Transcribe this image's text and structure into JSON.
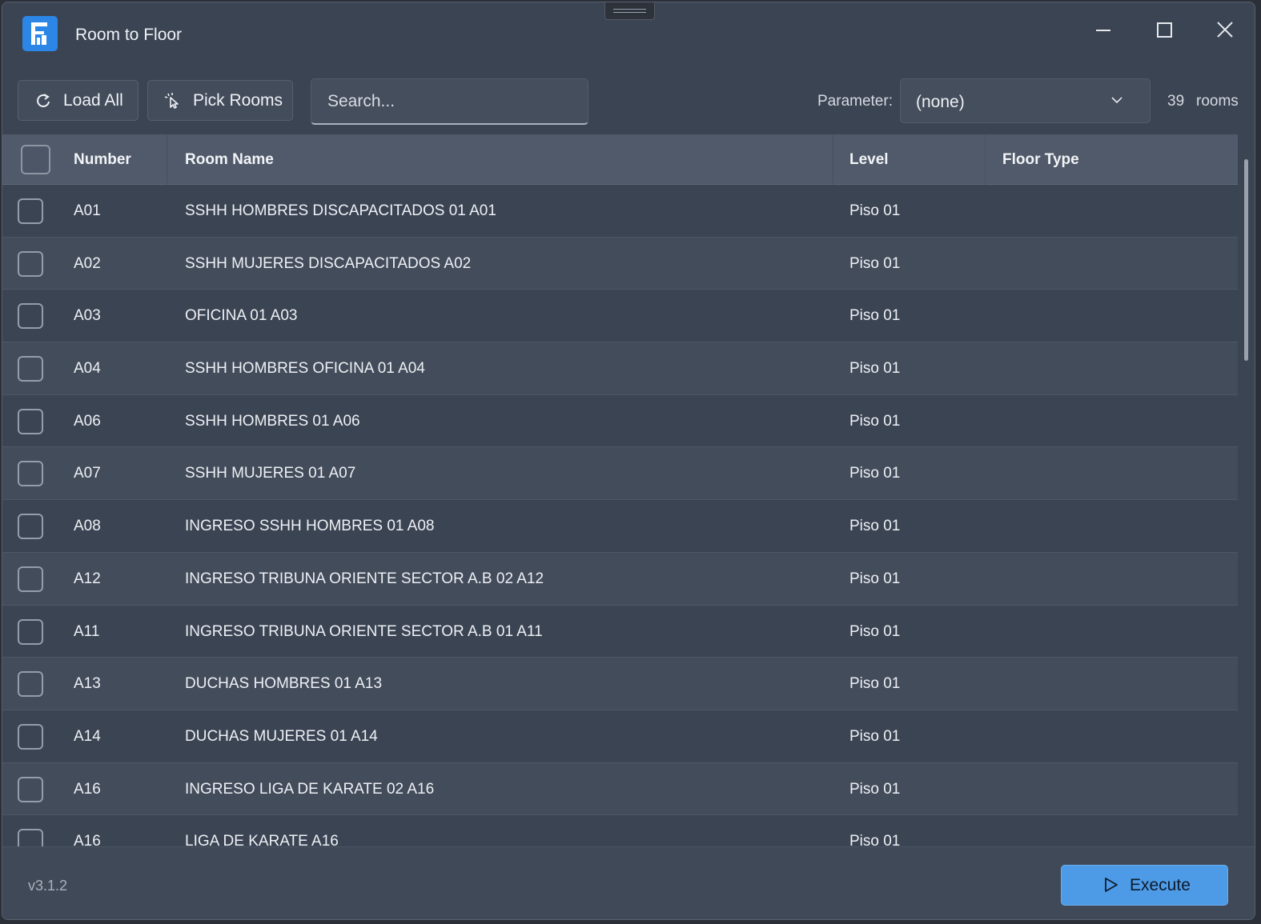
{
  "window": {
    "title": "Room to Floor",
    "app_icon": "revit-f-logo-icon",
    "controls": [
      "minimize-icon",
      "maximize-icon",
      "close-icon"
    ]
  },
  "toolbar": {
    "load_all_label": "Load All",
    "load_all_icon": "refresh-icon",
    "pick_rooms_label": "Pick Rooms",
    "pick_rooms_icon": "cursor-click-icon",
    "search_placeholder": "Search...",
    "parameter_label": "Parameter:",
    "parameter_value": "(none)",
    "room_count": "39",
    "room_count_label": "rooms"
  },
  "table": {
    "columns": {
      "number": "Number",
      "room_name": "Room Name",
      "level": "Level",
      "floor_type": "Floor Type"
    },
    "rows": [
      {
        "number": "A01",
        "name": "SSHH HOMBRES DISCAPACITADOS 01 A01",
        "level": "Piso 01",
        "floor_type": ""
      },
      {
        "number": "A02",
        "name": "SSHH MUJERES DISCAPACITADOS A02",
        "level": "Piso 01",
        "floor_type": ""
      },
      {
        "number": "A03",
        "name": "OFICINA 01 A03",
        "level": "Piso 01",
        "floor_type": ""
      },
      {
        "number": "A04",
        "name": "SSHH HOMBRES OFICINA 01 A04",
        "level": "Piso 01",
        "floor_type": ""
      },
      {
        "number": "A06",
        "name": "SSHH HOMBRES 01 A06",
        "level": "Piso 01",
        "floor_type": ""
      },
      {
        "number": "A07",
        "name": "SSHH MUJERES 01 A07",
        "level": "Piso 01",
        "floor_type": ""
      },
      {
        "number": "A08",
        "name": "INGRESO SSHH HOMBRES 01 A08",
        "level": "Piso 01",
        "floor_type": ""
      },
      {
        "number": "A12",
        "name": "INGRESO TRIBUNA ORIENTE SECTOR A.B 02 A12",
        "level": "Piso 01",
        "floor_type": ""
      },
      {
        "number": "A11",
        "name": "INGRESO TRIBUNA ORIENTE SECTOR A.B 01 A11",
        "level": "Piso 01",
        "floor_type": ""
      },
      {
        "number": "A13",
        "name": "DUCHAS HOMBRES 01 A13",
        "level": "Piso 01",
        "floor_type": ""
      },
      {
        "number": "A14",
        "name": "DUCHAS MUJERES 01 A14",
        "level": "Piso 01",
        "floor_type": ""
      },
      {
        "number": "A16",
        "name": "INGRESO LIGA DE KARATE 02 A16",
        "level": "Piso 01",
        "floor_type": ""
      },
      {
        "number": "A16",
        "name": "LIGA DE KARATE A16",
        "level": "Piso 01",
        "floor_type": ""
      }
    ]
  },
  "footer": {
    "version": "v3.1.2",
    "execute_label": "Execute",
    "execute_icon": "play-icon"
  },
  "colors": {
    "background": "#3b4453",
    "header": "#505a6a",
    "accent": "#4d9be6",
    "app_icon": "#2b86e6"
  }
}
